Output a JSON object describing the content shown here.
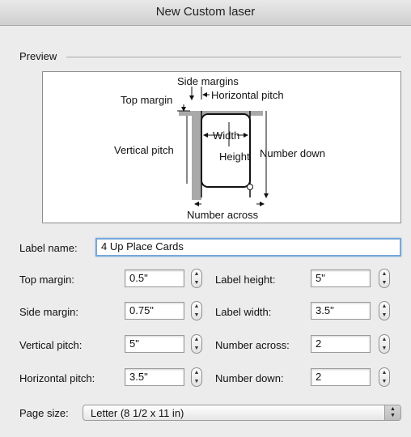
{
  "window": {
    "title": "New Custom laser"
  },
  "preview": {
    "group_label": "Preview",
    "labels": {
      "side_margins": "Side margins",
      "horizontal_pitch": "Horizontal pitch",
      "top_margin": "Top margin",
      "width": "Width",
      "vertical_pitch": "Vertical pitch",
      "height": "Height",
      "number_down": "Number down",
      "number_across": "Number across"
    }
  },
  "label_name": {
    "label": "Label name:",
    "value": "4 Up Place Cards"
  },
  "fields": {
    "top_margin": {
      "label": "Top margin:",
      "value": "0.5\""
    },
    "side_margin": {
      "label": "Side margin:",
      "value": "0.75\""
    },
    "vertical_pitch": {
      "label": "Vertical pitch:",
      "value": "5\""
    },
    "horizontal_pitch": {
      "label": "Horizontal pitch:",
      "value": "3.5\""
    },
    "label_height": {
      "label": "Label height:",
      "value": "5\""
    },
    "label_width": {
      "label": "Label width:",
      "value": "3.5\""
    },
    "number_across": {
      "label": "Number across:",
      "value": "2"
    },
    "number_down": {
      "label": "Number down:",
      "value": "2"
    }
  },
  "page_size": {
    "label": "Page size:",
    "value": "Letter (8 1/2 x 11 in)"
  }
}
